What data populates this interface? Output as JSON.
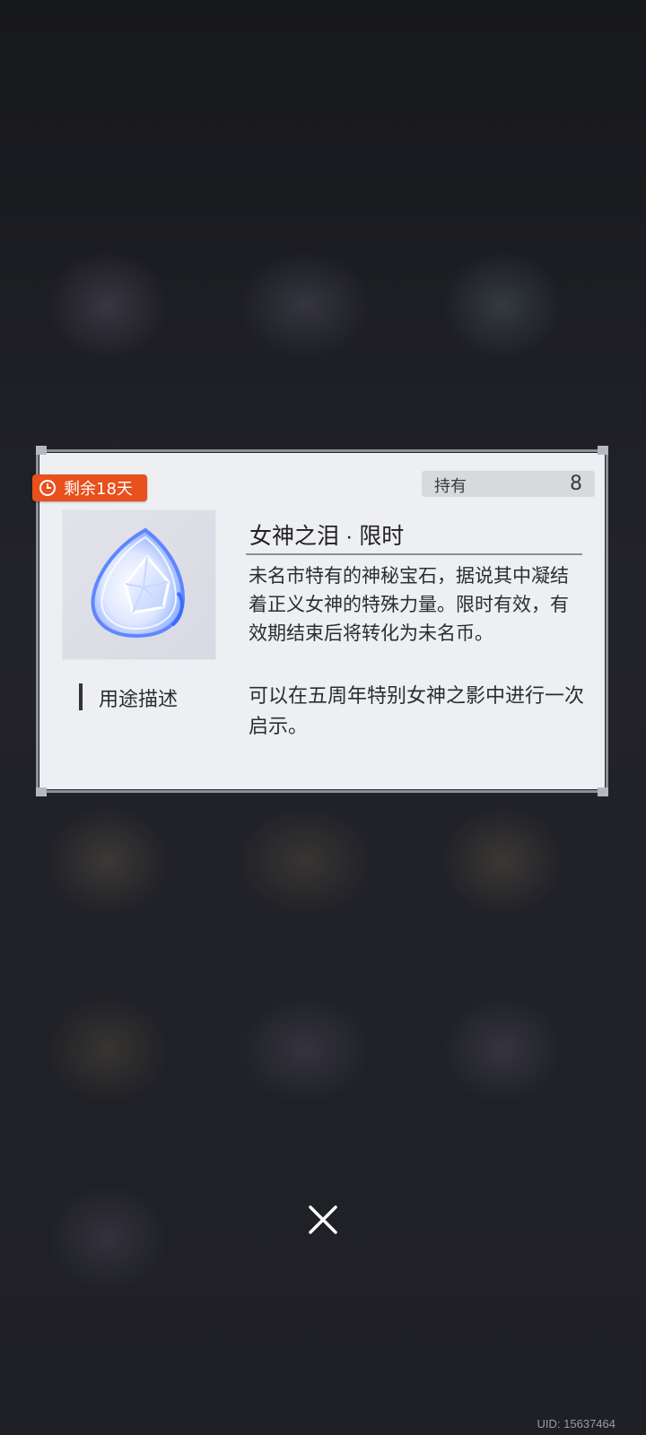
{
  "item": {
    "remaining_label": "剩余18天",
    "owned_label": "持有",
    "owned_count": "8",
    "name": "女神之泪 · 限时",
    "description": "未名市特有的神秘宝石，据说其中凝结着正义女神的特殊力量。限时有效，有效期结束后将转化为未名币。",
    "usage_label": "用途描述",
    "usage_text": "可以在五周年特别女神之影中进行一次启示。",
    "icon": "crystal-tear-icon"
  },
  "footer": {
    "uid": "UID: 15637464"
  },
  "colors": {
    "badge": "#e8501c",
    "card": "#eeeff2"
  }
}
